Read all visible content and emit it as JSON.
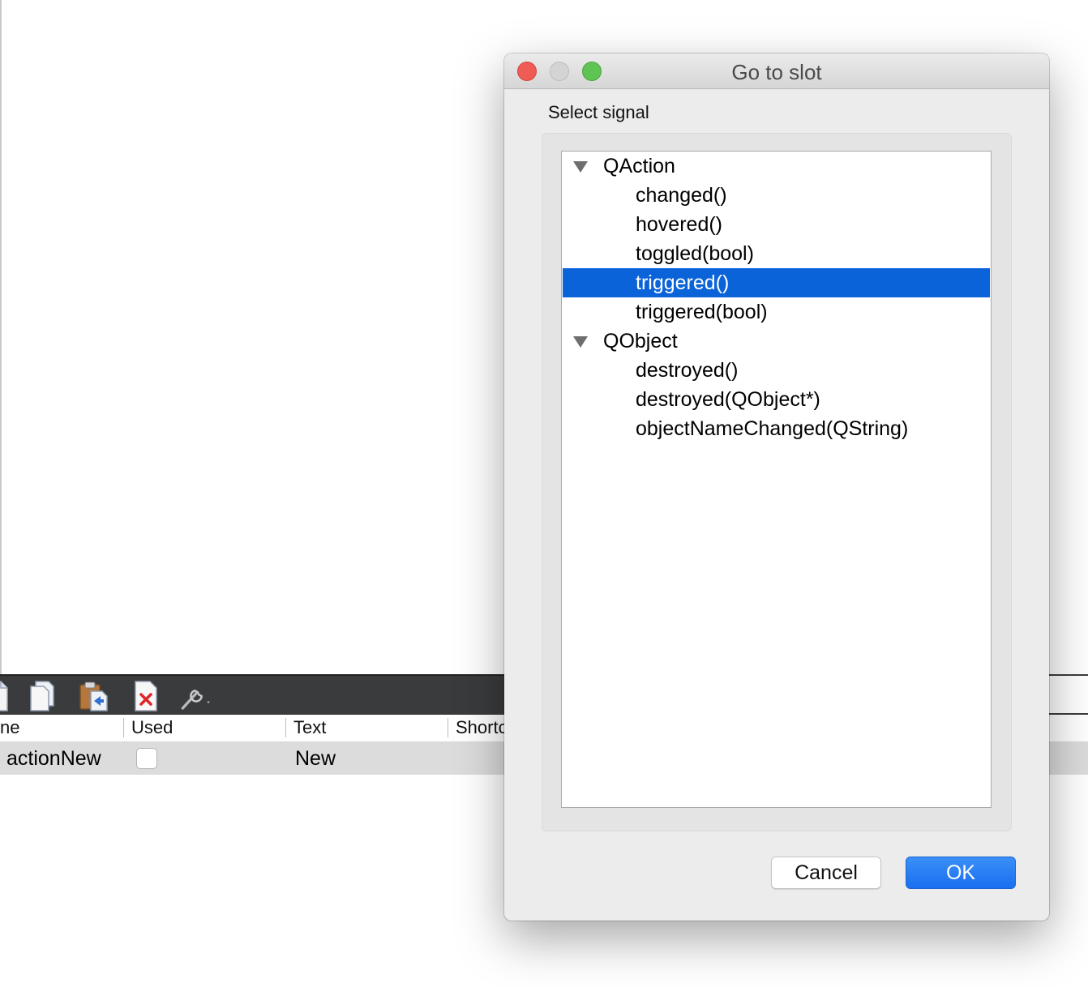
{
  "dialog": {
    "title": "Go to slot",
    "select_label": "Select signal",
    "tree": [
      {
        "type": "group",
        "label": "QAction",
        "expanded": true,
        "selected": false
      },
      {
        "type": "leaf",
        "label": "changed()",
        "selected": false
      },
      {
        "type": "leaf",
        "label": "hovered()",
        "selected": false
      },
      {
        "type": "leaf",
        "label": "toggled(bool)",
        "selected": false
      },
      {
        "type": "leaf",
        "label": "triggered()",
        "selected": true
      },
      {
        "type": "leaf",
        "label": "triggered(bool)",
        "selected": false
      },
      {
        "type": "group",
        "label": "QObject",
        "expanded": true,
        "selected": false
      },
      {
        "type": "leaf",
        "label": "destroyed()",
        "selected": false
      },
      {
        "type": "leaf",
        "label": "destroyed(QObject*)",
        "selected": false
      },
      {
        "type": "leaf",
        "label": "objectNameChanged(QString)",
        "selected": false
      }
    ],
    "cancel_label": "Cancel",
    "ok_label": "OK"
  },
  "action_editor": {
    "toolbar_icons": [
      "new-action-icon",
      "copy-icon",
      "paste-icon",
      "delete-icon",
      "configure-icon"
    ],
    "columns": [
      "ne",
      "Used",
      "Text",
      "Shortc"
    ],
    "rows": [
      {
        "name": "actionNew",
        "used": false,
        "text": "New"
      }
    ]
  },
  "colors": {
    "selection": "#0a63d8",
    "ok_button": "#1a6ff0",
    "toolbar": "#3a3b3d",
    "close_light": "#ee5c55",
    "zoom_light": "#5fc453"
  }
}
